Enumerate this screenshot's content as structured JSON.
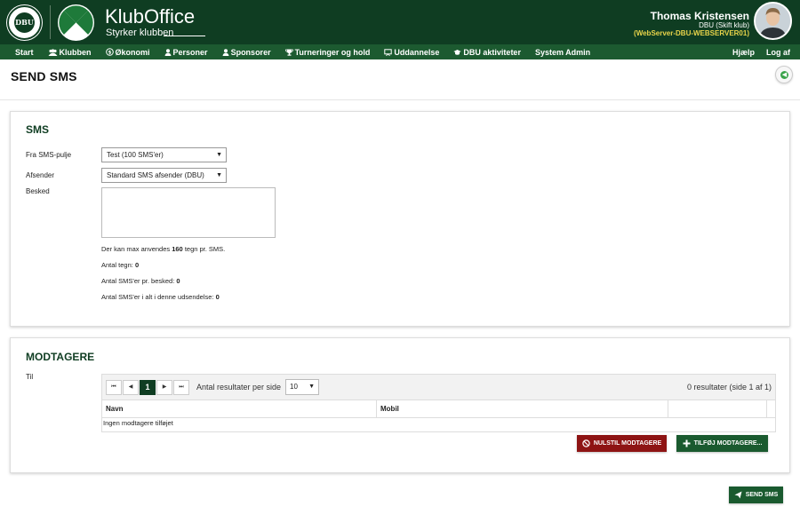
{
  "header": {
    "logo_text": "DBU",
    "app_title": "KlubOffice",
    "app_subtitle": "Styrker klubben",
    "user_name": "Thomas Kristensen",
    "user_club": "DBU (Skift klub)",
    "server": "(WebServer-DBU-WEBSERVER01)"
  },
  "nav": {
    "items": [
      {
        "label": "Start",
        "icon": ""
      },
      {
        "label": "Klubben",
        "icon": "people-icon"
      },
      {
        "label": "Økonomi",
        "icon": "coin-icon"
      },
      {
        "label": "Personer",
        "icon": "person-icon"
      },
      {
        "label": "Sponsorer",
        "icon": "sponsor-icon"
      },
      {
        "label": "Turneringer og hold",
        "icon": "trophy-icon"
      },
      {
        "label": "Uddannelse",
        "icon": "board-icon"
      },
      {
        "label": "DBU aktiviteter",
        "icon": "grad-cap-icon"
      },
      {
        "label": "System Admin",
        "icon": ""
      }
    ],
    "right": [
      {
        "label": "Hjælp"
      },
      {
        "label": "Log af"
      }
    ]
  },
  "page": {
    "title": "SEND SMS"
  },
  "sms": {
    "section_title": "SMS",
    "pool_label": "Fra SMS-pulje",
    "pool_value": "Test (100 SMS'er)",
    "sender_label": "Afsender",
    "sender_value": "Standard SMS afsender (DBU)",
    "message_label": "Besked",
    "message_value": "",
    "max_prefix": "Der kan max anvendes ",
    "max_value": "160",
    "max_suffix": " tegn pr. SMS.",
    "chars_label": "Antal tegn: ",
    "chars_value": "0",
    "per_msg_label": "Antal SMS'er pr. besked: ",
    "per_msg_value": "0",
    "total_label": "Antal SMS'er i alt i denne udsendelse: ",
    "total_value": "0"
  },
  "recipients": {
    "section_title": "MODTAGERE",
    "to_label": "Til",
    "pager": {
      "first": "⏮",
      "prev": "◀",
      "current": "1",
      "next": "▶",
      "last": "⏭"
    },
    "per_page_label": "Antal resultater per side",
    "per_page_value": "10",
    "results_text": "0 resultater (side 1 af 1)",
    "columns": [
      "Navn",
      "Mobil"
    ],
    "empty_text": "Ingen modtagere tilføjet",
    "reset_button": "NULSTIL MODTAGERE",
    "add_button": "TILFØJ MODTAGERE..."
  },
  "actions": {
    "send_button": "SEND SMS"
  },
  "colors": {
    "header_bg": "#0f3d22",
    "nav_bg": "#1c5a30",
    "danger": "#8e1414",
    "primary": "#1a5a2f",
    "server_text": "#e8d44a"
  }
}
